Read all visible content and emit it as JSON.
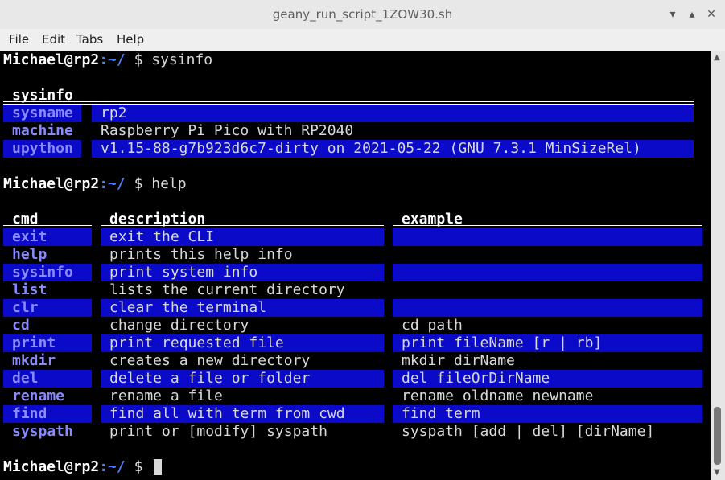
{
  "window": {
    "title": "geany_run_script_1ZOW30.sh",
    "minimize": "▾",
    "maximize": "▴",
    "close": "✕"
  },
  "menu": [
    "File",
    "Edit",
    "Tabs",
    "Help"
  ],
  "prompt": {
    "user": "Michael@rp2",
    "path": ":~/",
    "symbol": " $ "
  },
  "commands": {
    "first": "sysinfo",
    "second": "help"
  },
  "sysinfo_table": {
    "header": "sysinfo",
    "rows": [
      {
        "key": "sysname",
        "value": "rp2"
      },
      {
        "key": "machine",
        "value": "Raspberry Pi Pico with RP2040"
      },
      {
        "key": "upython",
        "value": "v1.15-88-g7b923d6c7-dirty on 2021-05-22 (GNU 7.3.1 MinSizeRel)"
      }
    ]
  },
  "help_table": {
    "headers": [
      "cmd",
      "description",
      "example"
    ],
    "rows": [
      {
        "cmd": "exit",
        "description": "exit the CLI",
        "example": ""
      },
      {
        "cmd": "help",
        "description": "prints this help info",
        "example": ""
      },
      {
        "cmd": "sysinfo",
        "description": "print system info",
        "example": ""
      },
      {
        "cmd": "list",
        "description": "lists the current directory",
        "example": ""
      },
      {
        "cmd": "clr",
        "description": "clear the terminal",
        "example": ""
      },
      {
        "cmd": "cd",
        "description": "change directory",
        "example": "cd path"
      },
      {
        "cmd": "print",
        "description": "print requested file",
        "example": "print fileName [r | rb]"
      },
      {
        "cmd": "mkdir",
        "description": "creates a new directory",
        "example": "mkdir dirName"
      },
      {
        "cmd": "del",
        "description": "delete a file or folder",
        "example": "del fileOrDirName"
      },
      {
        "cmd": "rename",
        "description": "rename a file",
        "example": "rename oldname newname"
      },
      {
        "cmd": "find",
        "description": "find all with term from cwd",
        "example": "find term"
      },
      {
        "cmd": "syspath",
        "description": "print or [modify] syspath",
        "example": "syspath [add | del] [dirName]"
      }
    ]
  },
  "colors": {
    "highlight": "#0a0ac8",
    "key": "#8a8aff",
    "path": "#4a7fff"
  }
}
